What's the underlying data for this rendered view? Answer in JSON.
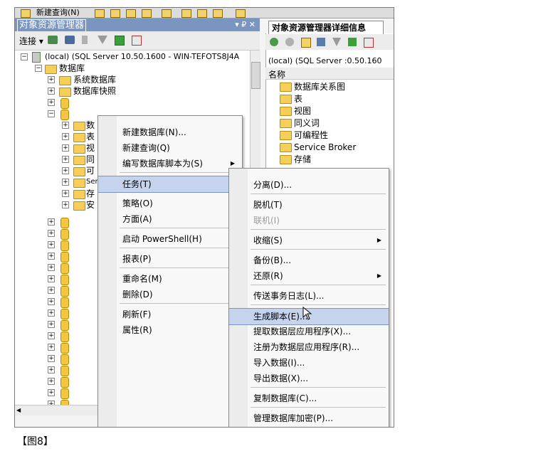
{
  "toolbar": {
    "new_query": "新建查询(N)"
  },
  "object_explorer": {
    "title": "对象资源管理器",
    "connect_label": "连接",
    "pin_controls": "▾ ₽ ✕"
  },
  "tree": {
    "server": "(local) (SQL Server 10.50.1600 - WIN-TEFOTS8J4A",
    "databases": "数据库",
    "system_databases": "系统数据库",
    "database_snapshots": "数据库快照",
    "child_items": [
      "数",
      "表",
      "视",
      "同",
      "可",
      "Ser",
      "存",
      "安"
    ]
  },
  "details": {
    "tab": "对象资源管理器详细信息",
    "path": "(local) (SQL Server :0.50.160",
    "column_header": "名称",
    "items": [
      "数据库关系图",
      "表",
      "视图",
      "同义词",
      "可编程性",
      "Service Broker",
      "存储"
    ]
  },
  "context_menu": {
    "items": [
      {
        "label": "新建数据库(N)...",
        "submenu": false
      },
      {
        "label": "新建查询(Q)",
        "submenu": false
      },
      {
        "label": "编写数据库脚本为(S)",
        "submenu": true
      },
      {
        "label": "任务(T)",
        "submenu": true
      },
      {
        "label": "策略(O)",
        "submenu": true
      },
      {
        "label": "方面(A)",
        "submenu": false
      },
      {
        "label": "启动 PowerShell(H)",
        "submenu": false
      },
      {
        "label": "报表(P)",
        "submenu": true
      },
      {
        "label": "重命名(M)",
        "submenu": false
      },
      {
        "label": "删除(D)",
        "submenu": false
      },
      {
        "label": "刷新(F)",
        "submenu": false
      },
      {
        "label": "属性(R)",
        "submenu": false
      }
    ]
  },
  "tasks_menu": {
    "items": [
      {
        "label": "分离(D)...",
        "submenu": false,
        "enabled": true
      },
      {
        "label": "脱机(T)",
        "submenu": false,
        "enabled": true
      },
      {
        "label": "联机(I)",
        "submenu": false,
        "enabled": false
      },
      {
        "label": "收缩(S)",
        "submenu": true,
        "enabled": true
      },
      {
        "label": "备份(B)...",
        "submenu": false,
        "enabled": true
      },
      {
        "label": "还原(R)",
        "submenu": true,
        "enabled": true
      },
      {
        "label": "传送事务日志(L)...",
        "submenu": false,
        "enabled": true
      },
      {
        "label": "生成脚本(E)...",
        "submenu": false,
        "enabled": true
      },
      {
        "label": "提取数据层应用程序(X)...",
        "submenu": false,
        "enabled": true
      },
      {
        "label": "注册为数据层应用程序(R)...",
        "submenu": false,
        "enabled": true
      },
      {
        "label": "导入数据(I)...",
        "submenu": false,
        "enabled": true
      },
      {
        "label": "导出数据(X)...",
        "submenu": false,
        "enabled": true
      },
      {
        "label": "复制数据库(C)...",
        "submenu": false,
        "enabled": true
      },
      {
        "label": "管理数据库加密(P)...",
        "submenu": false,
        "enabled": true
      }
    ]
  },
  "caption": "【图8】"
}
